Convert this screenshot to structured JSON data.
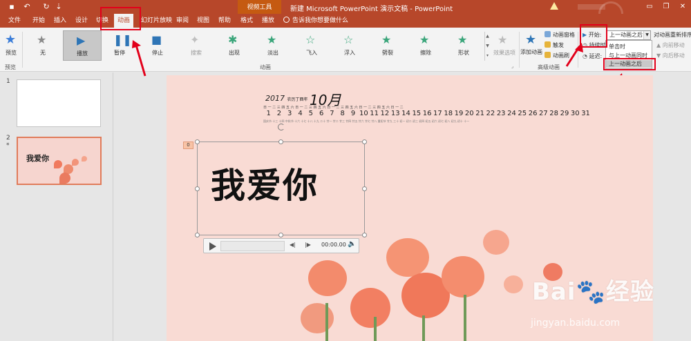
{
  "titlebar": {
    "context_group": "视频工具",
    "doc_title": "新建 Microsoft PowerPoint 演示文稿 - PowerPoint",
    "window_controls": [
      "minimize",
      "restore",
      "close"
    ]
  },
  "tabs": [
    "文件",
    "开始",
    "插入",
    "设计",
    "切换",
    "动画",
    "幻灯片放映",
    "审阅",
    "视图",
    "帮助",
    "格式",
    "播放"
  ],
  "active_tab": "动画",
  "tellme": "告诉我你想要做什么",
  "ribbon": {
    "preview": {
      "label": "预览",
      "group": "预览"
    },
    "animation_group": "动画",
    "animations": [
      {
        "label": "无",
        "icon": "star-icon"
      },
      {
        "label": "播放",
        "icon": "play-icon",
        "selected": true
      },
      {
        "label": "暂停",
        "icon": "pause-icon"
      },
      {
        "label": "停止",
        "icon": "stop-icon"
      },
      {
        "label": "搜索",
        "icon": "search-anim-icon",
        "disabled": true
      },
      {
        "label": "出现",
        "icon": "appear-icon"
      },
      {
        "label": "淡出",
        "icon": "fade-icon"
      },
      {
        "label": "飞入",
        "icon": "fly-in-icon"
      },
      {
        "label": "浮入",
        "icon": "float-in-icon"
      },
      {
        "label": "劈裂",
        "icon": "split-icon"
      },
      {
        "label": "擦除",
        "icon": "wipe-icon"
      },
      {
        "label": "形状",
        "icon": "shape-icon"
      }
    ],
    "effect_options": "效果选项",
    "advanced_group": "高级动画",
    "add_animation": "添加动画",
    "animation_pane": "动画窗格",
    "trigger": "触发",
    "animation_painter": "动画刷",
    "timing": {
      "start_label": "开始:",
      "start_value": "上一动画之后",
      "duration_label": "持续时",
      "delay_label": "延迟:",
      "reorder_label": "对动画重新排序",
      "move_earlier": "向前移动",
      "move_later": "向后移动"
    },
    "start_options": [
      "单击时",
      "与上一动画同时",
      "上一动画之后"
    ]
  },
  "thumbnails": [
    {
      "number": "1",
      "text": ""
    },
    {
      "number": "2",
      "star": "*",
      "text": "我爱你"
    }
  ],
  "slide": {
    "calendar_year": "2017",
    "calendar_year_sub": "农历丁酉年",
    "calendar_month": "10月",
    "calendar_top": "日 一 二 三 四 五 六 日 一 二 三 四 五 六 日 一 二 三 四 五 六 日 一 二 三 四 五 六 日 一 二",
    "calendar_days": [
      "1",
      "2",
      "3",
      "4",
      "5",
      "6",
      "7",
      "8",
      "9",
      "10",
      "11",
      "12",
      "13",
      "14",
      "15",
      "16",
      "17",
      "18",
      "19",
      "20",
      "21",
      "22",
      "23",
      "24",
      "25",
      "26",
      "27",
      "28",
      "29",
      "30",
      "31"
    ],
    "calendar_lunar": "国庆节 十三 十四 中秋节 十六 十七 十八 十九 二十 廿一 廿二 廿三 廿四 廿五 廿六 廿七 廿八 重阳节 廿九 三十 初一 初二 初三 初四 初五 初六 初七 初八 初九 初十 十一",
    "animation_badge": "0",
    "main_text": "我爱你",
    "audio_time": "00:00.00"
  },
  "watermark": {
    "logo": "Bai🐾经验",
    "url": "jingyan.baidu.com"
  },
  "colors": {
    "accent": "#b7472a",
    "highlight": "#e2001a"
  }
}
